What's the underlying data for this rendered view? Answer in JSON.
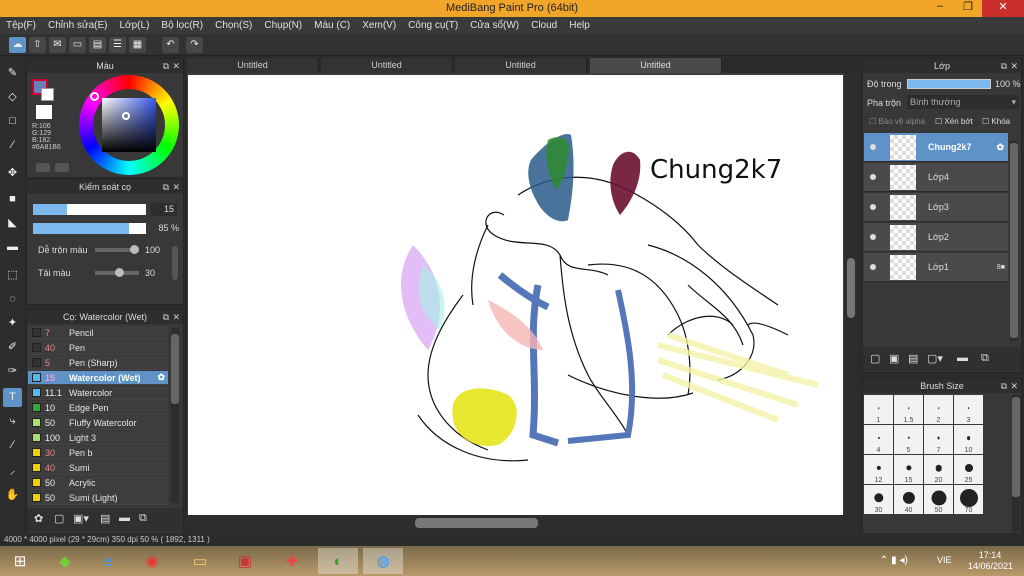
{
  "window": {
    "title": "MediBang Paint Pro (64bit)",
    "minimize": "–",
    "maximize": "❐",
    "close": "✕"
  },
  "menu": [
    "Tệp(F)",
    "Chỉnh sửa(E)",
    "Lớp(L)",
    "Bộ lọc(R)",
    "Chọn(S)",
    "Chụp(N)",
    "Màu (C)",
    "Xem(V)",
    "Công cụ(T)",
    "Cửa sổ(W)",
    "Cloud",
    "Help"
  ],
  "tabs": [
    "Untitled",
    "Untitled",
    "Untitled",
    "Untitled"
  ],
  "color_panel": {
    "title": "Màu",
    "r": "R:106",
    "g": "G:129",
    "b": "B:182",
    "hex": "#6A81B6",
    "fg": "#6A81B6"
  },
  "brush_control": {
    "title": "Kiểm soát cọ",
    "size": "15",
    "opacity": "85 %",
    "size_pct": 0.3,
    "opacity_pct": 0.85,
    "blend_label": "Dễ trộn màu",
    "blend_value": "100",
    "amount_label": "Tải màu",
    "amount_value": "30"
  },
  "brush_list": {
    "title": "Cọ: Watercolor (Wet)",
    "items": [
      {
        "num": "7",
        "name": "Pencil",
        "color": "#333333"
      },
      {
        "num": "40",
        "name": "Pen",
        "color": "#333333"
      },
      {
        "num": "5",
        "name": "Pen (Sharp)",
        "color": "#333333"
      },
      {
        "num": "15",
        "name": "Watercolor (Wet)",
        "color": "#57b8ef",
        "selected": true
      },
      {
        "num": "11.1",
        "name": "Watercolor",
        "color": "#57b8ef"
      },
      {
        "num": "10",
        "name": "Edge Pen",
        "color": "#38a838"
      },
      {
        "num": "50",
        "name": "Fluffy Watercolor",
        "color": "#a8e070"
      },
      {
        "num": "100",
        "name": "Light 3",
        "color": "#a8e070"
      },
      {
        "num": "30",
        "name": "Pen b",
        "color": "#f0d000"
      },
      {
        "num": "40",
        "name": "Sumi",
        "color": "#f0d000"
      },
      {
        "num": "50",
        "name": "Acrylic",
        "color": "#f0d000"
      },
      {
        "num": "50",
        "name": "Sumi (Light)",
        "color": "#f0d000"
      }
    ]
  },
  "layer_panel": {
    "title": "Lớp",
    "opacity_label": "Độ trong",
    "opacity_value": "100 %",
    "blend_label": "Pha trộn",
    "blend_value": "Bình thường",
    "protect_alpha": "Bảo vệ alpha",
    "clip": "Xén bớt",
    "lock": "Khóa",
    "layers": [
      {
        "name": "Chung2k7",
        "selected": true
      },
      {
        "name": "Lớp4"
      },
      {
        "name": "Lớp3"
      },
      {
        "name": "Lớp2"
      },
      {
        "name": "Lớp1",
        "badge": "8"
      }
    ]
  },
  "brush_size": {
    "title": "Brush Size",
    "sizes": [
      "1",
      "1.5",
      "2",
      "3",
      "4",
      "5",
      "7",
      "10",
      "12",
      "15",
      "20",
      "25",
      "30",
      "40",
      "50",
      "70"
    ]
  },
  "canvas": {
    "signature": "Chung2k7"
  },
  "status": "4000 * 4000 pixel  (29 * 29cm)  350 dpi  50 %  ( 1892, 1311 )",
  "taskbar": {
    "lang": "VIE",
    "time": "17:14",
    "date": "14/06/2021"
  }
}
